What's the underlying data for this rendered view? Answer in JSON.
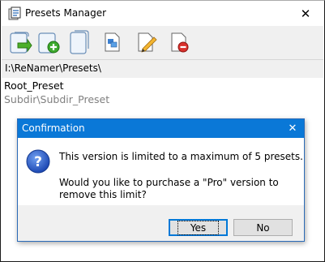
{
  "window": {
    "title": "Presets Manager",
    "close_glyph": "✕"
  },
  "toolbar": {
    "buttons": [
      {
        "icon": "load-preset-icon"
      },
      {
        "icon": "add-preset-icon"
      },
      {
        "icon": "presets-icon"
      },
      {
        "icon": "rename-icon"
      },
      {
        "icon": "edit-icon"
      },
      {
        "icon": "delete-icon"
      }
    ]
  },
  "path": {
    "text": "I:\\ReNamer\\Presets\\"
  },
  "list": {
    "items": [
      {
        "label": "Root_Preset"
      },
      {
        "label": "Subdir\\Subdir_Preset"
      }
    ]
  },
  "dialog": {
    "title": "Confirmation",
    "close_glyph": "✕",
    "message_line1": "This version is limited to a maximum of 5 presets.",
    "message_line2": "Would you like to purchase a \"Pro\" version to remove this limit?",
    "yes_label": "Yes",
    "no_label": "No"
  },
  "colors": {
    "dialog_title_bg": "#0a78d7",
    "toolbar_bg": "#f0f0f0"
  }
}
